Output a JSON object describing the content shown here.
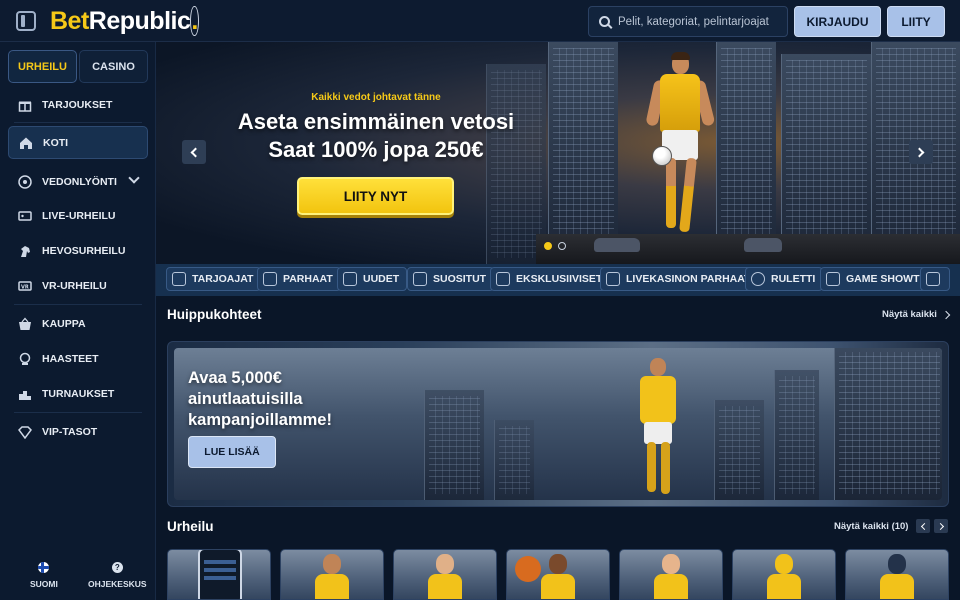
{
  "header": {
    "logo_part1": "Bet",
    "logo_part2": "Republic",
    "logo_dot": ".",
    "search_placeholder": "Pelit, kategoriat, pelintarjoajat",
    "login_label": "KIRJAUDU",
    "join_label": "LIITY"
  },
  "sidebar": {
    "tabs": [
      "URHEILU",
      "CASINO"
    ],
    "items": [
      {
        "label": "TARJOUKSET",
        "icon": "gift-icon"
      },
      {
        "label": "KOTI",
        "icon": "home-icon"
      },
      {
        "label": "VEDONLYÖNTI",
        "icon": "soccer-ball-icon"
      },
      {
        "label": "LIVE-URHEILU",
        "icon": "live-tv-icon"
      },
      {
        "label": "HEVOSURHEILU",
        "icon": "horse-icon"
      },
      {
        "label": "VR-URHEILU",
        "icon": "vr-icon"
      },
      {
        "label": "KAUPPA",
        "icon": "basket-icon"
      },
      {
        "label": "HAASTEET",
        "icon": "trophy-icon"
      },
      {
        "label": "TURNAUKSET",
        "icon": "podium-icon"
      },
      {
        "label": "VIP-TASOT",
        "icon": "diamond-icon"
      }
    ],
    "footer": {
      "language": "SUOMI",
      "help": "OHJEKESKUS"
    }
  },
  "hero": {
    "subtitle": "Kaikki vedot johtavat tänne",
    "line1": "Aseta ensimmäinen vetosi",
    "line2": "Saat 100% jopa 250€",
    "cta": "LIITY NYT",
    "slide_count": 2,
    "active_slide": 1
  },
  "categories": [
    {
      "label": "TARJOAJAT",
      "icon": "providers-icon"
    },
    {
      "label": "PARHAAT",
      "icon": "crown-icon"
    },
    {
      "label": "UUDET",
      "icon": "lightning-icon"
    },
    {
      "label": "SUOSITUT",
      "icon": "flame-icon"
    },
    {
      "label": "EKSKLUSIIVISET",
      "icon": "diamond-icon"
    },
    {
      "label": "LIVEKASINON PARHAAT",
      "icon": "star-icon"
    },
    {
      "label": "RULETTI",
      "icon": "roulette-icon"
    },
    {
      "label": "GAME SHOWT",
      "icon": "host-icon"
    }
  ],
  "highlights": {
    "title": "Huippukohteet",
    "see_all": "Näytä kaikki",
    "promo_title": "Avaa 5,000€ ainutlaatuisilla kampanjoillamme!",
    "promo_button": "LUE LISÄÄ"
  },
  "sports": {
    "title": "Urheilu",
    "see_all": "Näytä kaikki (10)"
  },
  "colors": {
    "accent": "#f6c918",
    "bg": "#0a1628",
    "button": "#a8c1e8"
  }
}
